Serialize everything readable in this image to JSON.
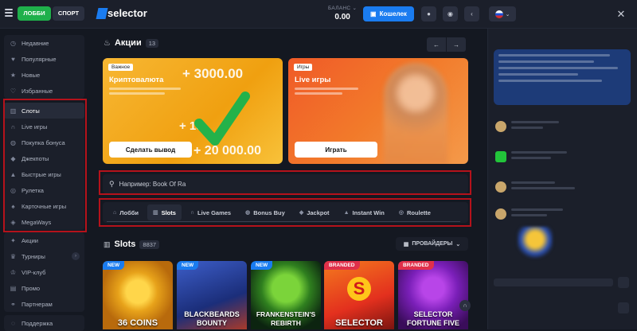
{
  "topbar": {
    "lobby_label": "ЛОББИ",
    "sport_label": "СПОРТ",
    "logo_text": "selector",
    "balance_label": "БАЛАНС",
    "balance_value": "0.00",
    "wallet_label": "Кошелек"
  },
  "sidebar": {
    "group1": [
      {
        "label": "Недавние",
        "icon": "clock-icon"
      },
      {
        "label": "Популярные",
        "icon": "heart-icon"
      },
      {
        "label": "Новые",
        "icon": "star-icon"
      },
      {
        "label": "Избранные",
        "icon": "heart-outline-icon"
      }
    ],
    "group2": [
      {
        "label": "Слоты",
        "icon": "slot-icon"
      },
      {
        "label": "Live игры",
        "icon": "headset-icon"
      },
      {
        "label": "Покупка бонуса",
        "icon": "bonus-icon"
      },
      {
        "label": "Джекпоты",
        "icon": "diamond-icon"
      },
      {
        "label": "Быстрые игры",
        "icon": "flame-icon"
      },
      {
        "label": "Рулетка",
        "icon": "roulette-icon"
      },
      {
        "label": "Карточные игры",
        "icon": "cards-icon"
      },
      {
        "label": "MegaWays",
        "icon": "tag-icon"
      }
    ],
    "group3": [
      {
        "label": "Акции",
        "icon": "gift-icon"
      },
      {
        "label": "Турниры",
        "icon": "trophy-icon"
      },
      {
        "label": "VIP-клуб",
        "icon": "crown-icon"
      },
      {
        "label": "Промо",
        "icon": "promo-icon"
      },
      {
        "label": "Партнерам",
        "icon": "handshake-icon"
      }
    ],
    "group4": [
      {
        "label": "Поддержка",
        "icon": "support-icon"
      }
    ]
  },
  "promos": {
    "title": "Акции",
    "count": "13",
    "banners": [
      {
        "tag": "Важное",
        "title": "Криптовалюта",
        "button": "Сделать вывод",
        "amounts": [
          "+ 3000.00",
          "+ 15",
          "+ 20 000.00"
        ]
      },
      {
        "tag": "Игры",
        "title": "Live игры",
        "button": "Играть"
      }
    ]
  },
  "search": {
    "placeholder": "Например: Book Of Ra"
  },
  "tabs": [
    {
      "label": "Лобби",
      "icon": "home-icon"
    },
    {
      "label": "Slots",
      "icon": "slot-icon"
    },
    {
      "label": "Live Games",
      "icon": "headset-icon"
    },
    {
      "label": "Bonus Buy",
      "icon": "bonus-icon"
    },
    {
      "label": "Jackpot",
      "icon": "diamond-icon"
    },
    {
      "label": "Instant Win",
      "icon": "flame-icon"
    },
    {
      "label": "Roulette",
      "icon": "roulette-icon"
    }
  ],
  "slots": {
    "title": "Slots",
    "count": "8837",
    "providers_label": "ПРОВАЙДЕРЫ",
    "games": [
      {
        "badge": "NEW",
        "title": "36 COINS",
        "badge_color": "#1a7cf0"
      },
      {
        "badge": "NEW",
        "title": "BLACKBEARDS BOUNTY",
        "badge_color": "#1a7cf0"
      },
      {
        "badge": "NEW",
        "title": "FRANKENSTEIN'S REBIRTH",
        "badge_color": "#1a7cf0"
      },
      {
        "badge": "BRANDED",
        "title": "SELECTOR",
        "badge_color": "#e0304a"
      },
      {
        "badge": "BRANDED",
        "title": "SELECTOR FORTUNE FIVE",
        "badge_color": "#e0304a"
      }
    ]
  },
  "colors": {
    "accent": "#1a7cf0",
    "lobby_green": "#1fb04b",
    "highlight_red": "#b5121b"
  }
}
